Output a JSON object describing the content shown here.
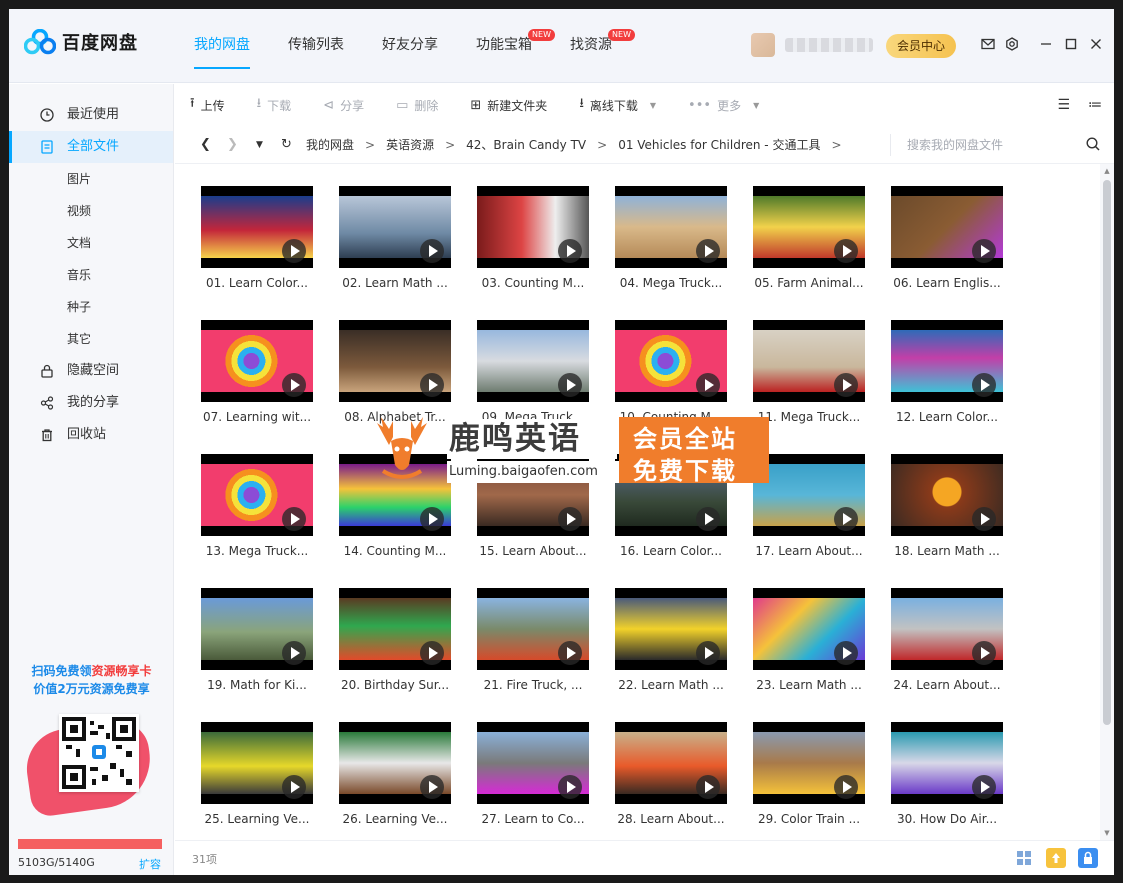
{
  "app": {
    "name": "百度网盘"
  },
  "nav": {
    "tabs": [
      {
        "label": "我的网盘",
        "active": true
      },
      {
        "label": "传输列表"
      },
      {
        "label": "好友分享"
      },
      {
        "label": "功能宝箱",
        "badge": "NEW"
      },
      {
        "label": "找资源",
        "badge": "NEW"
      }
    ]
  },
  "header": {
    "vip_label": "会员中心"
  },
  "sidebar": {
    "items": [
      {
        "label": "最近使用"
      },
      {
        "label": "全部文件",
        "active": true
      },
      {
        "label": "隐藏空间"
      },
      {
        "label": "我的分享"
      },
      {
        "label": "回收站"
      }
    ],
    "subitems": [
      "图片",
      "视频",
      "文档",
      "音乐",
      "种子",
      "其它"
    ],
    "promo": {
      "line1_a": "扫码免费领",
      "line1_b": "资源畅享卡",
      "line2": "价值2万元资源免费享"
    },
    "storage": {
      "text": "5103G/5140G",
      "used": 5103,
      "total": 5140,
      "expand": "扩容"
    }
  },
  "toolbar": {
    "upload": "上传",
    "download": "下载",
    "share": "分享",
    "delete": "删除",
    "new_folder": "新建文件夹",
    "offline_download": "离线下载",
    "more": "更多"
  },
  "breadcrumb": {
    "items": [
      "我的网盘",
      "英语资源",
      "42、Brain Candy TV",
      "01 Vehicles for Children - 交通工具"
    ],
    "separator": ">"
  },
  "search": {
    "placeholder": "搜索我的网盘文件"
  },
  "files": [
    "01. Learn Color...",
    "02. Learn Math ...",
    "03. Counting M...",
    "04. Mega Truck...",
    "05. Farm Animal...",
    "06. Learn Englis...",
    "07. Learning wit...",
    "08. Alphabet Tr...",
    "09. Mega Truck...",
    "10. Counting M...",
    "11. Mega Truck...",
    "12. Learn Color...",
    "13. Mega Truck...",
    "14. Counting M...",
    "15. Learn About...",
    "16. Learn Color...",
    "17. Learn About...",
    "18. Learn Math ...",
    "19. Math for Ki...",
    "20. Birthday Sur...",
    "21. Fire Truck, ...",
    "22. Learn Math ...",
    "23. Learn Math ...",
    "24. Learn About...",
    "25. Learning Ve...",
    "26. Learning Ve...",
    "27. Learn to Co...",
    "28. Learn About...",
    "29. Color Train ...",
    "30. How Do Air..."
  ],
  "status": {
    "count": "31项"
  },
  "watermark": {
    "title": "鹿鸣英语",
    "url": "Luming.baigaofen.com",
    "line1": "会员全站",
    "line2": "免费下载"
  },
  "colors": {
    "accent": "#06a7ff",
    "vip": "#f5c250",
    "storage_bar": "#f56060",
    "watermark": "#f07d2c"
  }
}
